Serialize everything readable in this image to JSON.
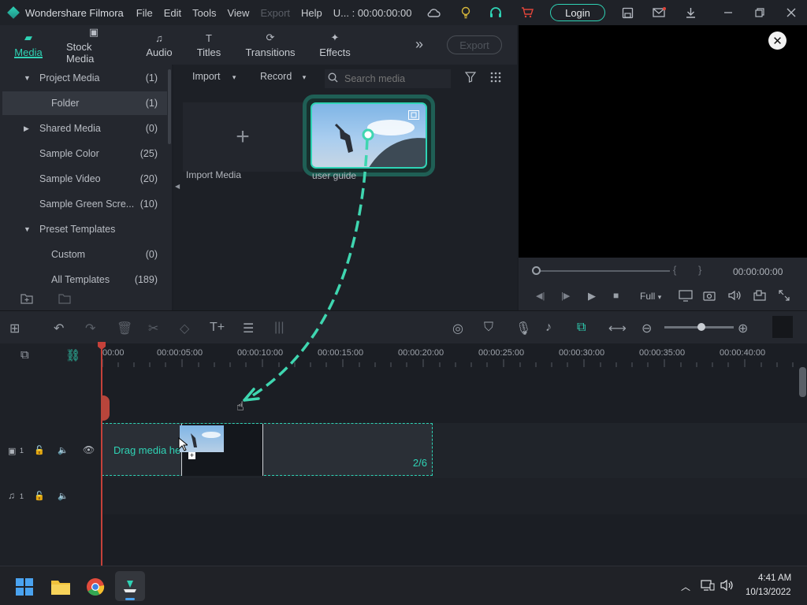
{
  "window": {
    "title": "Wondershare Filmora",
    "menu": [
      "File",
      "Edit",
      "Tools",
      "View",
      "Export",
      "Help"
    ],
    "project_title": "U... : 00:00:00:00",
    "login_label": "Login"
  },
  "tabs": [
    {
      "label": "Media",
      "icon": "media-icon",
      "active": true
    },
    {
      "label": "Stock Media",
      "icon": "stock-media-icon"
    },
    {
      "label": "Audio",
      "icon": "music-note-icon"
    },
    {
      "label": "Titles",
      "icon": "text-t-icon"
    },
    {
      "label": "Transitions",
      "icon": "transition-icon"
    },
    {
      "label": "Effects",
      "icon": "sparkle-icon"
    }
  ],
  "export_label": "Export",
  "sidebar": {
    "items": [
      {
        "label": "Project Media",
        "count": "(1)"
      },
      {
        "label": "Folder",
        "count": "(1)"
      },
      {
        "label": "Shared Media",
        "count": "(0)"
      },
      {
        "label": "Sample Color",
        "count": "(25)"
      },
      {
        "label": "Sample Video",
        "count": "(20)"
      },
      {
        "label": "Sample Green Scre...",
        "count": "(10)"
      },
      {
        "label": "Preset Templates",
        "count": ""
      },
      {
        "label": "Custom",
        "count": "(0)"
      },
      {
        "label": "All Templates",
        "count": "(189)"
      }
    ]
  },
  "media": {
    "import_label": "Import",
    "record_label": "Record",
    "search_placeholder": "Search media",
    "import_media_label": "Import Media",
    "clip_label": "user guide"
  },
  "preview": {
    "timecode": "00:00:00:00",
    "quality": "Full",
    "brackets": [
      "{",
      "}"
    ]
  },
  "timeline": {
    "ticks": [
      "00:00",
      "00:00:05:00",
      "00:00:10:00",
      "00:00:15:00",
      "00:00:20:00",
      "00:00:25:00",
      "00:00:30:00",
      "00:00:35:00",
      "00:00:40:00"
    ],
    "drop_text": "Drag media here to edit it",
    "drop_count": "2/6",
    "video_track_label": "1",
    "audio_track_label": "1"
  },
  "taskbar": {
    "time": "4:41 AM",
    "date": "10/13/2022"
  },
  "colors": {
    "accent": "#2fd3b5",
    "playhead": "#c5413a"
  }
}
